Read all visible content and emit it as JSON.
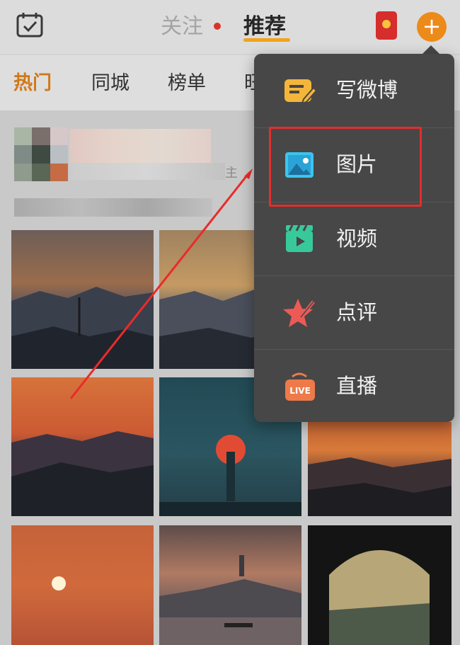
{
  "header": {
    "tabs": [
      {
        "label": "关注",
        "has_dot": true
      },
      {
        "label": "推荐",
        "active": true
      }
    ],
    "icons": {
      "calendar": "calendar-check-icon",
      "red_packet": "red-packet-icon",
      "plus": "plus-icon"
    },
    "plus_symbol": "+"
  },
  "categories": [
    "热门",
    "同城",
    "榜单",
    "旺"
  ],
  "post": {
    "meta_suffix": "主"
  },
  "menu": {
    "items": [
      {
        "label": "写微博",
        "icon": "compose-icon"
      },
      {
        "label": "图片",
        "icon": "image-icon",
        "highlighted": true
      },
      {
        "label": "视频",
        "icon": "video-icon"
      },
      {
        "label": "点评",
        "icon": "review-star-icon"
      },
      {
        "label": "直播",
        "icon": "live-icon",
        "icon_text": "LIVE"
      }
    ]
  },
  "colors": {
    "accent_orange": "#ec8a1a",
    "highlight_red": "#e42d2d",
    "menu_bg": "#474747"
  }
}
